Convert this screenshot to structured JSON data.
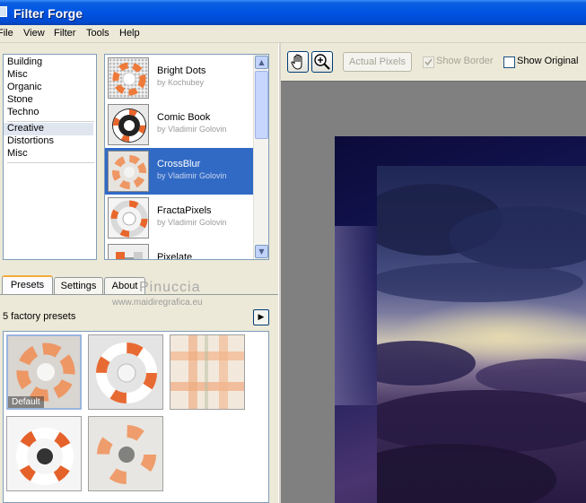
{
  "window": {
    "title": "Filter Forge"
  },
  "menu": [
    "File",
    "View",
    "Filter",
    "Tools",
    "Help"
  ],
  "categories": {
    "group1": [
      "Building",
      "Misc",
      "Organic",
      "Stone",
      "Techno"
    ],
    "group2": [
      "Creative",
      "Distortions",
      "Misc"
    ],
    "selected": "Creative"
  },
  "filters": [
    {
      "name": "Bright Dots",
      "author": "by Kochubey"
    },
    {
      "name": "Comic Book",
      "author": "by Vladimir Golovin"
    },
    {
      "name": "CrossBlur",
      "author": "by Vladimir Golovin",
      "selected": true
    },
    {
      "name": "FractaPixels",
      "author": "by Vladimir Golovin"
    },
    {
      "name": "Pixelate",
      "author": ""
    }
  ],
  "tabs": [
    "Presets",
    "Settings",
    "About"
  ],
  "active_tab": "Presets",
  "watermark": {
    "name": "Pinuccia",
    "url": "www.maidiregrafica.eu"
  },
  "presets": {
    "count_label": "5 factory presets",
    "default_label": "Default",
    "play_icon": "triangle-right-icon"
  },
  "toolbar": {
    "hand_icon": "hand-icon",
    "zoom_icon": "zoom-in-icon",
    "actual_pixels": "Actual Pixels",
    "show_border": "Show Border",
    "show_original": "Show Original"
  },
  "colors": {
    "titlebar": "#0054e3",
    "selection": "#316ac5",
    "tab_accent": "#f3a93b",
    "preview_bg": "#808080"
  }
}
